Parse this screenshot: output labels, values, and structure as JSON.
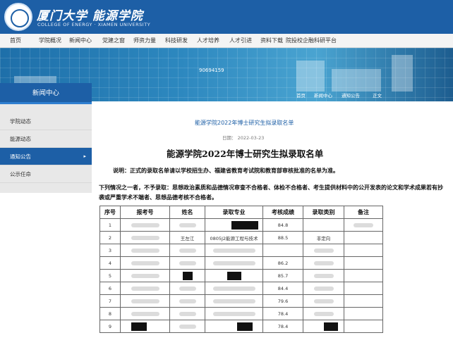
{
  "header": {
    "logo_cn": "厦门大学 能源学院",
    "logo_en": "COLLEGE OF ENERGY · XIAMEN UNIVERSITY"
  },
  "nav": {
    "items": [
      {
        "label": "首页"
      },
      {
        "label": "学院概况"
      },
      {
        "label": "新闻中心"
      },
      {
        "label": "党建之窗"
      },
      {
        "label": "师资力量"
      },
      {
        "label": "科技研发"
      },
      {
        "label": "人才培养"
      },
      {
        "label": "人才引进"
      },
      {
        "label": "资料下载"
      },
      {
        "label": "院投校企融科研平台"
      }
    ]
  },
  "banner": {
    "number": "90694159",
    "breadcrumb": [
      "首页",
      "新闻中心",
      "通知公告",
      "正文"
    ]
  },
  "sidebar": {
    "title": "新闻中心",
    "items": [
      {
        "label": "学院动态"
      },
      {
        "label": "能源动态"
      },
      {
        "label": "通知公告"
      },
      {
        "label": "公示任命"
      }
    ]
  },
  "article": {
    "small_title": "能源学院2022年博士研究生拟录取名单",
    "date": "日期： 2022-03-23",
    "title": "能源学院2022年博士研究生拟录取名单",
    "note": "说明：正式的录取名单请以学校招生办、福建省教育考试院和教育部审核批准的名单为准。",
    "para": "下列情况之一者，不予录取：思想政治素质和品德情况审查不合格者、体检不合格者、考生提供材料中的公开发表的论文和学术成果若有抄袭或严重学术不端者、思想品德考核不合格者。"
  },
  "table": {
    "headers": [
      "序号",
      "报考号",
      "姓名",
      "录取专业",
      "考核成绩",
      "录取类别",
      "备注"
    ],
    "rows": [
      {
        "no": "1",
        "name": "",
        "major": "",
        "score": "84.8",
        "category": ""
      },
      {
        "no": "2",
        "name": "王左江",
        "major": "0805J2能源工程与技术",
        "score": "88.5",
        "category": "非定向"
      },
      {
        "no": "3",
        "name": "",
        "major": "",
        "score": "",
        "category": ""
      },
      {
        "no": "4",
        "name": "",
        "major": "",
        "score": "86.2",
        "category": ""
      },
      {
        "no": "5",
        "name": "",
        "major": "",
        "score": "85.7",
        "category": ""
      },
      {
        "no": "6",
        "name": "",
        "major": "",
        "score": "84.4",
        "category": ""
      },
      {
        "no": "7",
        "name": "",
        "major": "",
        "score": "79.6",
        "category": ""
      },
      {
        "no": "8",
        "name": "",
        "major": "",
        "score": "78.4",
        "category": ""
      },
      {
        "no": "9",
        "name": "",
        "major": "",
        "score": "78.4",
        "category": ""
      }
    ]
  }
}
